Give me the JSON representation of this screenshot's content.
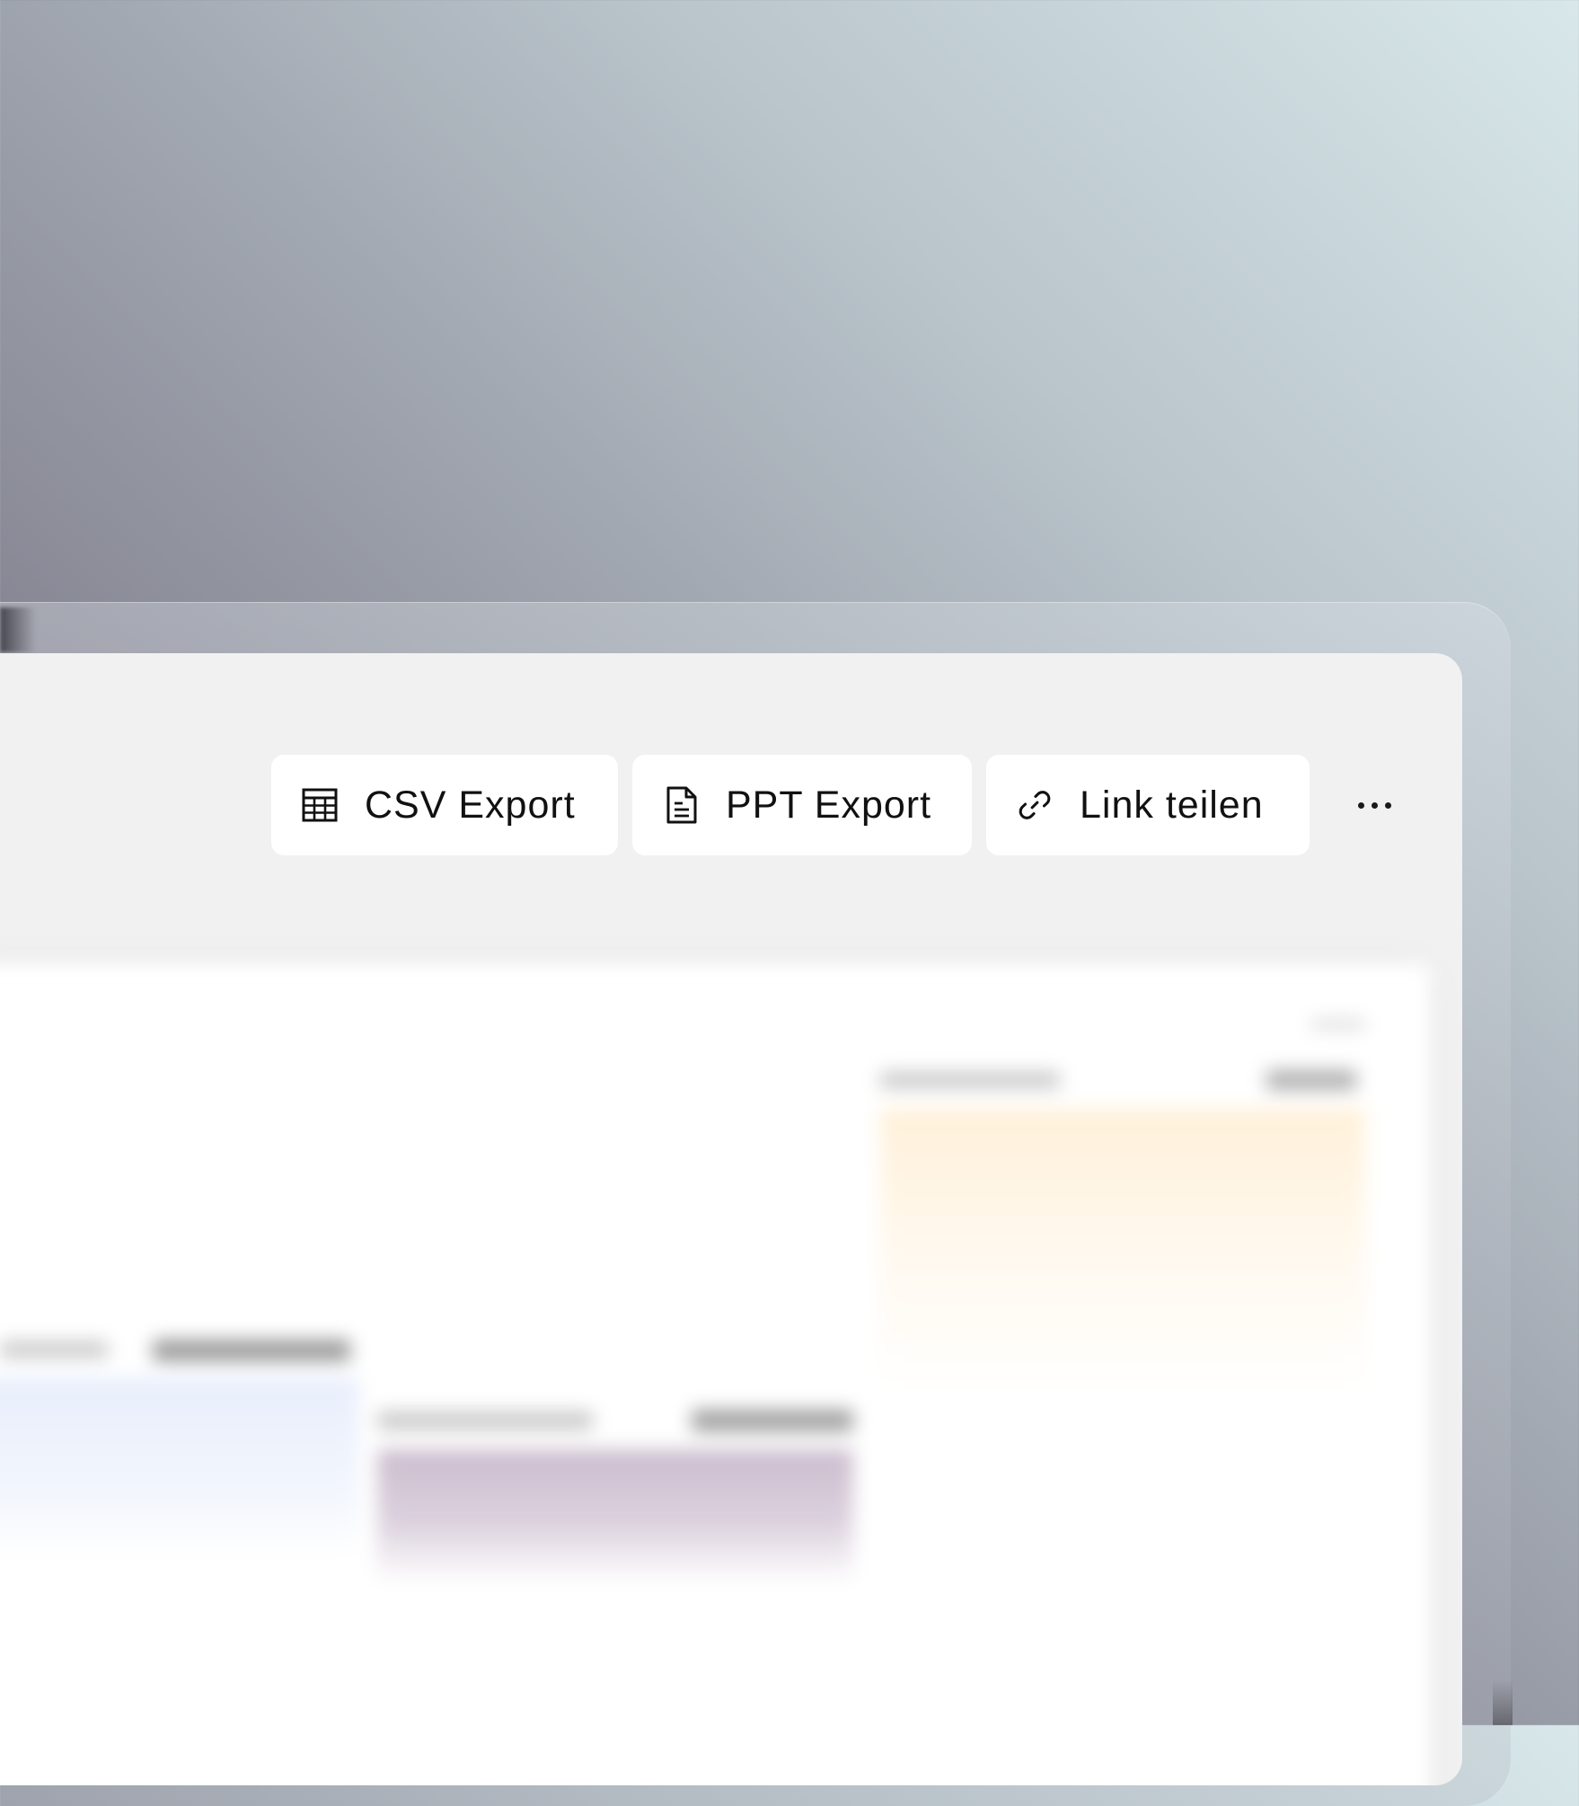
{
  "toolbar": {
    "csv_export_label": "CSV Export",
    "ppt_export_label": "PPT Export",
    "share_link_label": "Link teilen",
    "more_icon": "more-horizontal-icon"
  },
  "icons": {
    "csv": "table-icon",
    "ppt": "document-icon",
    "share": "link-icon"
  },
  "colors": {
    "window_bg": "#f1f1f1",
    "button_bg": "#ffffff",
    "text": "#111111",
    "accent_yellow": "#fff1da",
    "accent_blue": "#e8eefc",
    "accent_purple": "#cbbcce"
  }
}
